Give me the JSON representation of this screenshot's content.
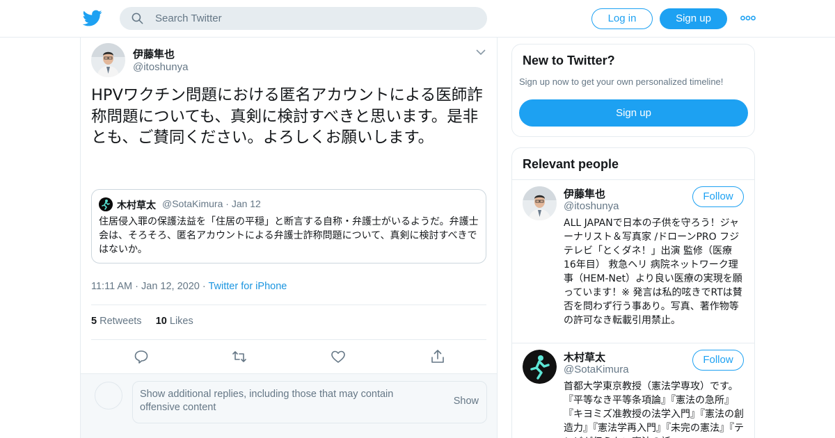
{
  "header": {
    "logo_icon": "twitter-bird-icon",
    "search_placeholder": "Search Twitter",
    "login_label": "Log in",
    "signup_label": "Sign up",
    "more_icon": "more-dots-icon",
    "brand_color": "#1da1f2"
  },
  "tweet": {
    "author_name": "伊藤隼也",
    "author_handle": "@itoshunya",
    "text": "HPVワクチン問題における匿名アカウントによる医師詐称問題についても、真剣に検討すべきと思います。是非とも、ご賛同ください。よろしくお願いします。",
    "quote": {
      "author_name": "木村草太",
      "author_handle": "@SotaKimura",
      "date": "Jan 12",
      "text": "住居侵入罪の保護法益を「住居の平穏」と断言する自称・弁護士がいるようだ。弁護士会は、そろそろ、匿名アカウントによる弁護士詐称問題について、真剣に検討すべきではないか。"
    },
    "time": "11:11 AM",
    "date": "Jan 12, 2020",
    "source": "Twitter for iPhone",
    "retweets_count": "5",
    "retweets_label": "Retweets",
    "likes_count": "10",
    "likes_label": "Likes",
    "actions": [
      "reply-icon",
      "retweet-icon",
      "like-icon",
      "share-icon"
    ]
  },
  "replies": {
    "message": "Show additional replies, including those that may contain offensive content",
    "show_label": "Show"
  },
  "sidebar": {
    "new_to_twitter": {
      "title": "New to Twitter?",
      "subtitle": "Sign up now to get your own personalized timeline!",
      "button_label": "Sign up"
    },
    "relevant_people": {
      "title": "Relevant people",
      "people": [
        {
          "name": "伊藤隼也",
          "handle": "@itoshunya",
          "follow_label": "Follow",
          "bio": "ALL JAPANで日本の子供を守ろう！ジャーナリスト＆写真家 /ドローンPRO フジテレビ「とくダネ！」出演 監修（医療 16年目） 救急ヘリ 病院ネットワーク理事（HEM-Net）より良い医療の実現を願っています！※ 発言は私的呟きでRTは賛否を問わず行う事あり。写真、著作物等の許可なき転載引用禁止。"
        },
        {
          "name": "木村草太",
          "handle": "@SotaKimura",
          "follow_label": "Follow",
          "bio": "首都大学東京教授（憲法学専攻）です。 『平等なき平等条項論』『憲法の急所』『キヨミズ准教授の法学入門』『憲法の創造力』『憲法学再入門』『未完の憲法』『テレビが伝えない憲法の話』"
        }
      ]
    }
  }
}
